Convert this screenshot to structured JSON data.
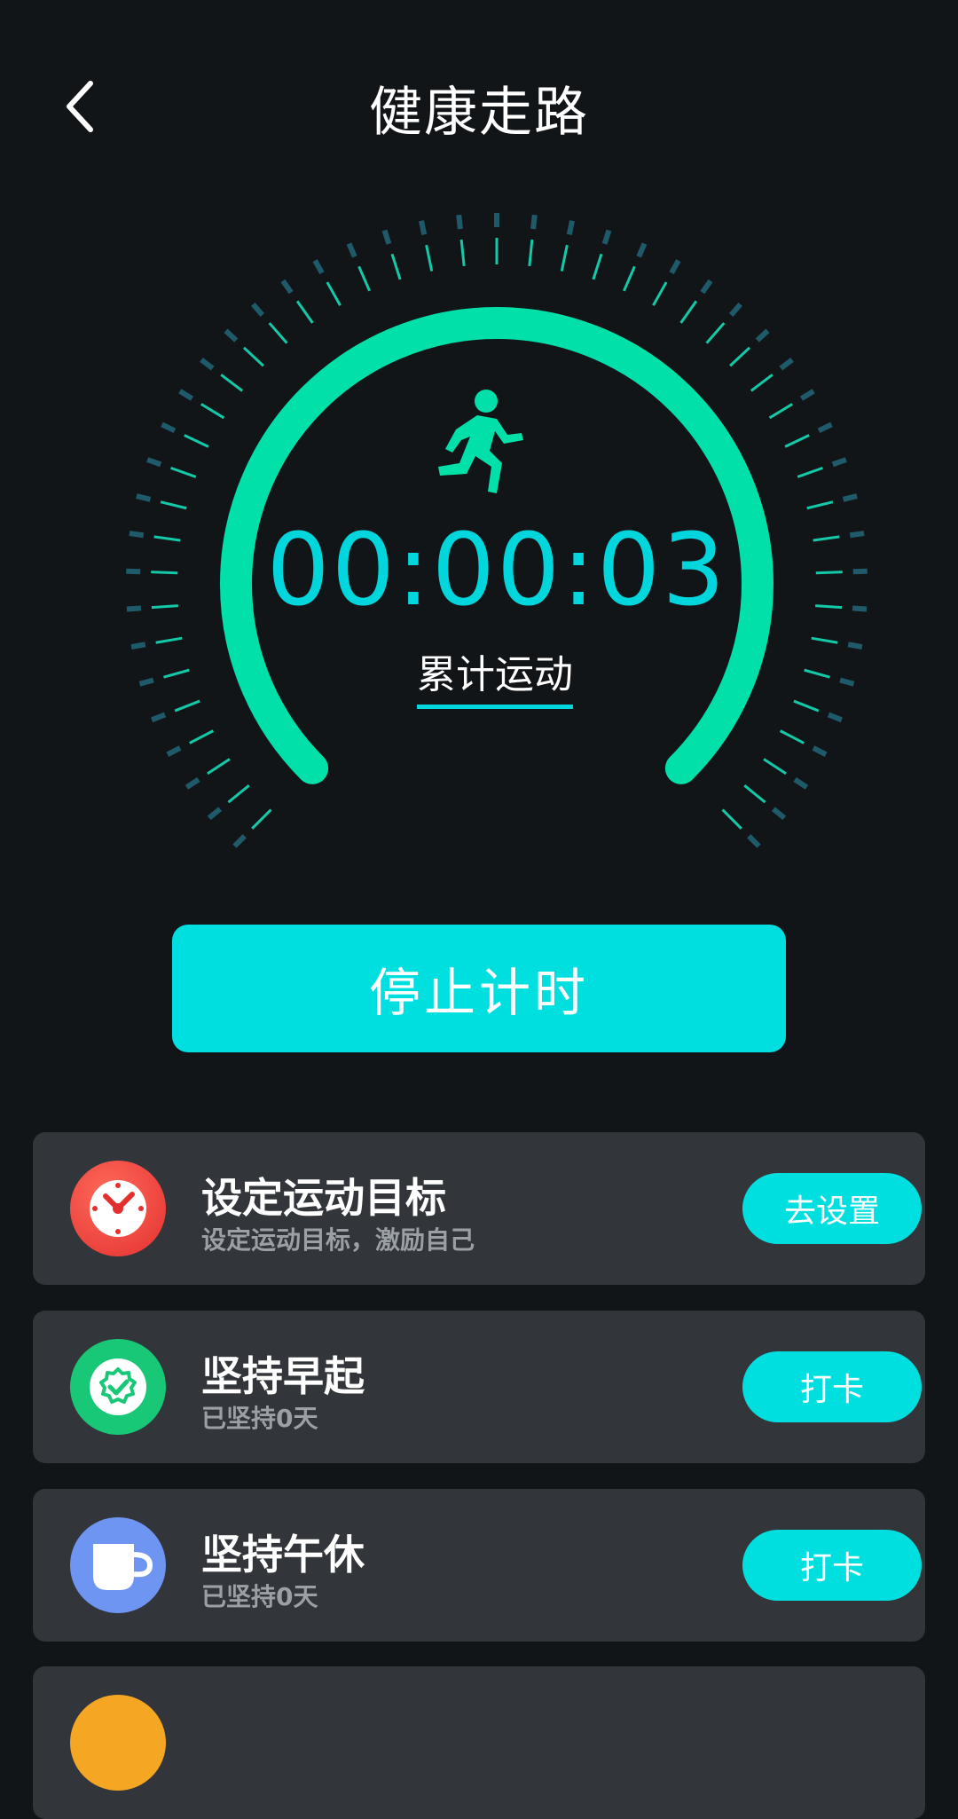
{
  "header": {
    "title": "健康走路"
  },
  "timer": {
    "value": "00:00:03",
    "label": "累计运动"
  },
  "stop_button": {
    "label": "停止计时"
  },
  "cards": [
    {
      "title": "设定运动目标",
      "subtitle": "设定运动目标，激励自己",
      "button": "去设置",
      "icon": "clock-icon",
      "icon_color": "#f2403f"
    },
    {
      "title": "坚持早起",
      "subtitle": "已坚持0天",
      "button": "打卡",
      "icon": "badge-check-icon",
      "icon_color": "#18c877"
    },
    {
      "title": "坚持午休",
      "subtitle": "已坚持0天",
      "button": "打卡",
      "icon": "cup-icon",
      "icon_color": "#6f95f2"
    }
  ],
  "colors": {
    "background": "#121518",
    "accent": "#00dfe0",
    "gauge_arc": "#00e0a8",
    "card": "#32363a"
  }
}
